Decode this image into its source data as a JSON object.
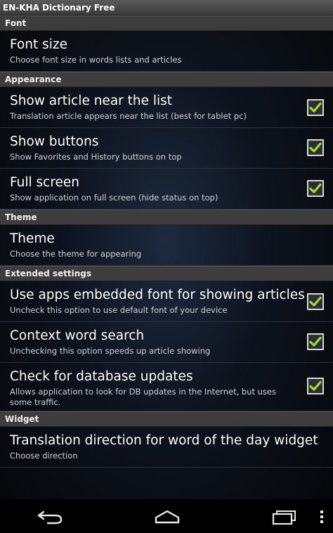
{
  "app": {
    "title": "EN-KHA Dictionary Free"
  },
  "colors": {
    "check_mark": "#9be02f",
    "section_header_bg": "#3d3d3d"
  },
  "sections": [
    {
      "header": "Font",
      "items": [
        {
          "title": "Font size",
          "summary": "Choose font size in words lists and articles",
          "checkbox": null
        }
      ]
    },
    {
      "header": "Appearance",
      "items": [
        {
          "title": "Show article near the list",
          "summary": "Translation article appears near the list (best for tablet pc)",
          "checked": true
        },
        {
          "title": "Show buttons",
          "summary": "Show Favorites and History buttons on top",
          "checked": true
        },
        {
          "title": "Full screen",
          "summary": "Show application on full screen (hide status on top)",
          "checked": true
        }
      ]
    },
    {
      "header": "Theme",
      "items": [
        {
          "title": "Theme",
          "summary": "Choose the theme for appearing"
        }
      ]
    },
    {
      "header": "Extended settings",
      "items": [
        {
          "title": "Use apps embedded font for showing articles",
          "summary": "Uncheck this option to use default font of your device",
          "checked": true
        },
        {
          "title": "Context word search",
          "summary": "Unchecking this option speeds up article showing",
          "checked": true
        },
        {
          "title": "Check for database updates",
          "summary": "Allows application to look for DB updates in the Internet, but uses some traffic.",
          "checked": true
        }
      ]
    },
    {
      "header": "Widget",
      "items": [
        {
          "title": "Translation direction for word of the day widget",
          "summary": "Choose direction"
        }
      ]
    }
  ],
  "navbar": {
    "icons": [
      "back-icon",
      "home-icon",
      "recent-apps-icon",
      "overflow-menu-icon"
    ]
  }
}
